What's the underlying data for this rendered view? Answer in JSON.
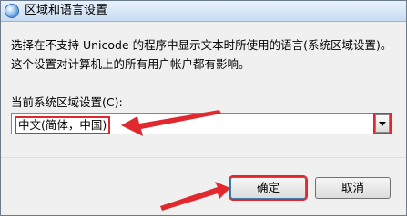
{
  "window": {
    "title": "区域和语言设置",
    "icon": "globe-icon"
  },
  "content": {
    "description": "选择在不支持 Unicode 的程序中显示文本时所使用的语言(系统区域设置)。这个设置对计算机上的所有用户帐户都有影响。",
    "locale_label": "当前系统区域设置(C):",
    "locale_value": "中文(简体，中国)"
  },
  "buttons": {
    "ok": "确定",
    "cancel": "取消"
  },
  "colors": {
    "annotation": "#e0282e",
    "title_bar": "#c9dcf2"
  }
}
